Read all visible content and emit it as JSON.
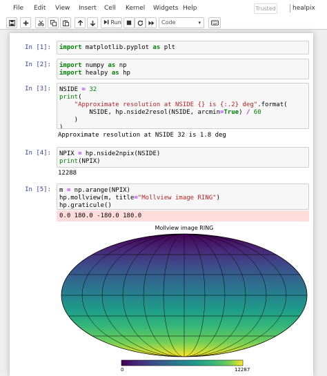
{
  "menu": {
    "items": [
      "File",
      "Edit",
      "View",
      "Insert",
      "Cell",
      "Kernel",
      "Widgets",
      "Help"
    ],
    "trusted": "Trusted",
    "kernel": "healpix"
  },
  "toolbar": {
    "buttons": [
      "save-icon",
      "plus-icon",
      "cut-icon",
      "copy-icon",
      "paste-icon",
      "arrow-up-icon",
      "arrow-down-icon",
      "step-forward-icon",
      "stop-icon",
      "restart-icon",
      "fast-forward-icon",
      "keyboard-icon"
    ],
    "run_label": "Run",
    "cell_type": "Code"
  },
  "cells": [
    {
      "prompt": "In [1]:",
      "code": "import matplotlib.pyplot as plt"
    },
    {
      "prompt": "In [2]:",
      "code": "import numpy as np\nimport healpy as hp"
    },
    {
      "prompt": "In [3]:",
      "code": "NSIDE = 32\nprint(\n    \"Approximate resolution at NSIDE {} is {:.2} deg\".format(\n        NSIDE, hp.nside2resol(NSIDE, arcmin=True) / 60\n    )\n)",
      "output": "Approximate resolution at NSIDE 32 is 1.8 deg"
    },
    {
      "prompt": "In [4]:",
      "code": "NPIX = hp.nside2npix(NSIDE)\nprint(NPIX)",
      "output": "12288"
    },
    {
      "prompt": "In [5]:",
      "code": "m = np.arange(NPIX)\nhp.mollview(m, title=\"Mollview image RING\")\nhp.graticule()",
      "stderr": "0.0 180.0 -180.0 180.0"
    }
  ],
  "plot": {
    "title": "Mollview image RING",
    "colormap": "viridis",
    "colorbar_min": "0",
    "colorbar_max": "12287"
  }
}
